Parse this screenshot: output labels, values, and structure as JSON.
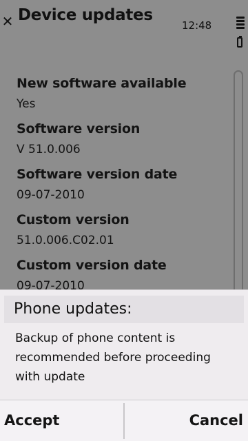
{
  "titlebar": {
    "close_glyph": "✕",
    "title": "Device updates",
    "clock": "12:48"
  },
  "fields": [
    {
      "label": "New software available",
      "value": "Yes"
    },
    {
      "label": "Software version",
      "value": "V 51.0.006"
    },
    {
      "label": "Software version date",
      "value": "09-07-2010"
    },
    {
      "label": "Custom version",
      "value": "51.0.006.C02.01"
    },
    {
      "label": "Custom version date",
      "value": "09-07-2010"
    }
  ],
  "dialog": {
    "title": "Phone updates:",
    "body": "Backup of phone content is recommended before proceeding with update"
  },
  "softkeys": {
    "left": "Accept",
    "right": "Cancel"
  },
  "colors": {
    "dimmed_background": "#8d8d8d",
    "dialog_background": "#efecef",
    "softkey_background": "#f4f2f5"
  },
  "icons": {
    "close": "close-icon",
    "signal": "signal-strength-icon",
    "battery": "battery-icon"
  }
}
